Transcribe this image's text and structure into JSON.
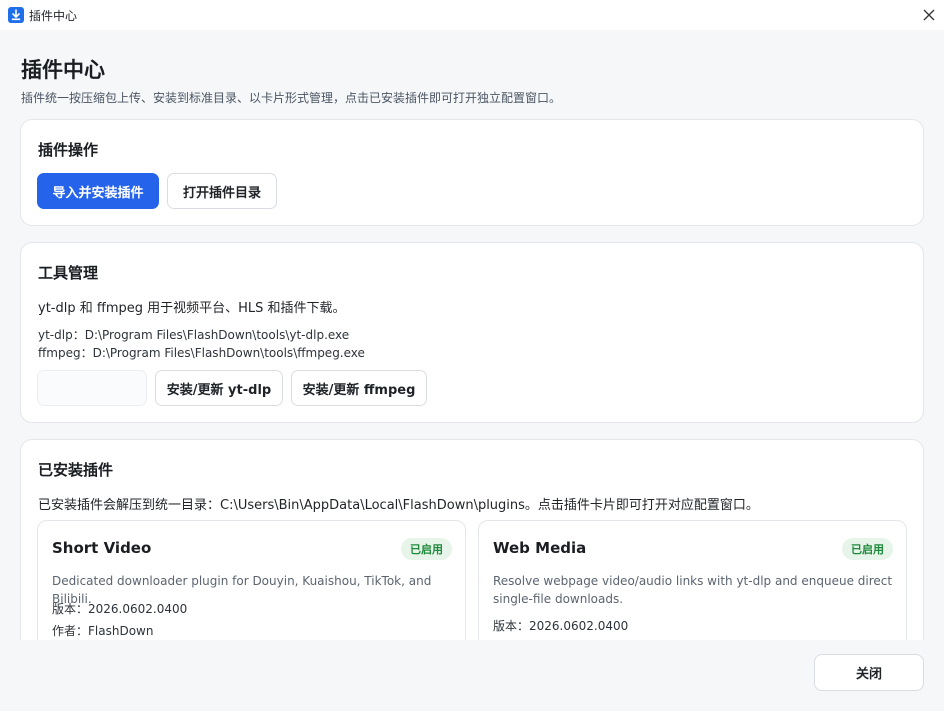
{
  "window": {
    "title": "插件中心",
    "accent": "#2563eb"
  },
  "header": {
    "title": "插件中心",
    "subtitle": "插件统一按压缩包上传、安装到标准目录、以卡片形式管理，点击已安装插件即可打开独立配置窗口。"
  },
  "plugin_actions": {
    "title": "插件操作",
    "import_label": "导入并安装插件",
    "open_dir_label": "打开插件目录"
  },
  "tools": {
    "title": "工具管理",
    "description": "yt-dlp 和 ffmpeg 用于视频平台、HLS 和插件下载。",
    "ytdlp_path": "yt-dlp：D:\\Program Files\\FlashDown\\tools\\yt-dlp.exe",
    "ffmpeg_path": "ffmpeg：D:\\Program Files\\FlashDown\\tools\\ffmpeg.exe",
    "install_ytdlp_label": "安装/更新 yt-dlp",
    "install_ffmpeg_label": "安装/更新 ffmpeg"
  },
  "installed": {
    "title": "已安装插件",
    "description": "已安装插件会解压到统一目录：C:\\Users\\Bin\\AppData\\Local\\FlashDown\\plugins。点击插件卡片即可打开对应配置窗口。",
    "plugins": [
      {
        "name": "Short Video",
        "status": "已启用",
        "description": "Dedicated downloader plugin for Douyin, Kuaishou, TikTok, and Bilibili.",
        "version": "版本：2026.0602.0400",
        "author": "作者：FlashDown"
      },
      {
        "name": "Web Media",
        "status": "已启用",
        "description": "Resolve webpage video/audio links with yt-dlp and enqueue direct single-file downloads.",
        "version": "版本：2026.0602.0400"
      }
    ]
  },
  "footer": {
    "close_label": "关闭"
  }
}
